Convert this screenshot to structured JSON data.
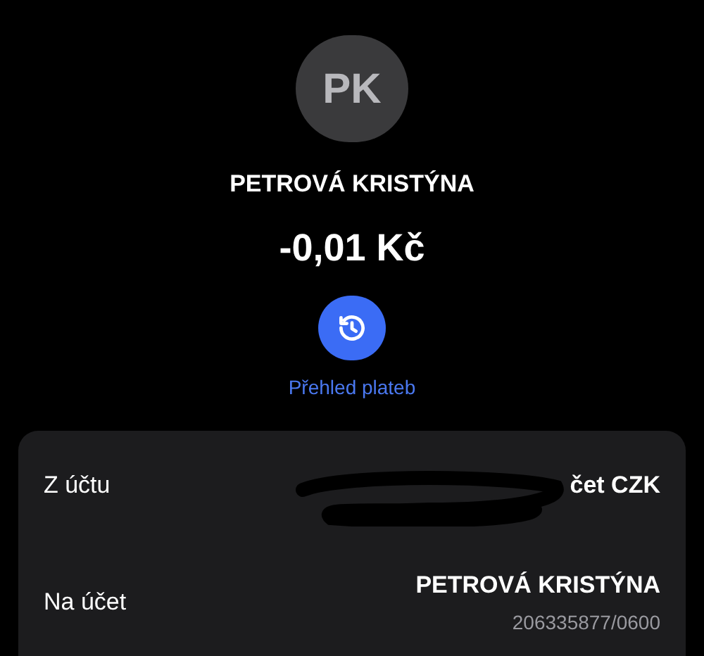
{
  "avatar": {
    "initials": "PK"
  },
  "name": "PETROVÁ KRISTÝNA",
  "amount": "-0,01 Kč",
  "history": {
    "label": "Přehled plateb"
  },
  "details": [
    {
      "label": "Z účtu",
      "value": "čet CZK",
      "redacted": true
    },
    {
      "label": "Na účet",
      "value": "PETROVÁ KRISTÝNA",
      "sub": "206335877/0600",
      "redacted": false
    }
  ]
}
